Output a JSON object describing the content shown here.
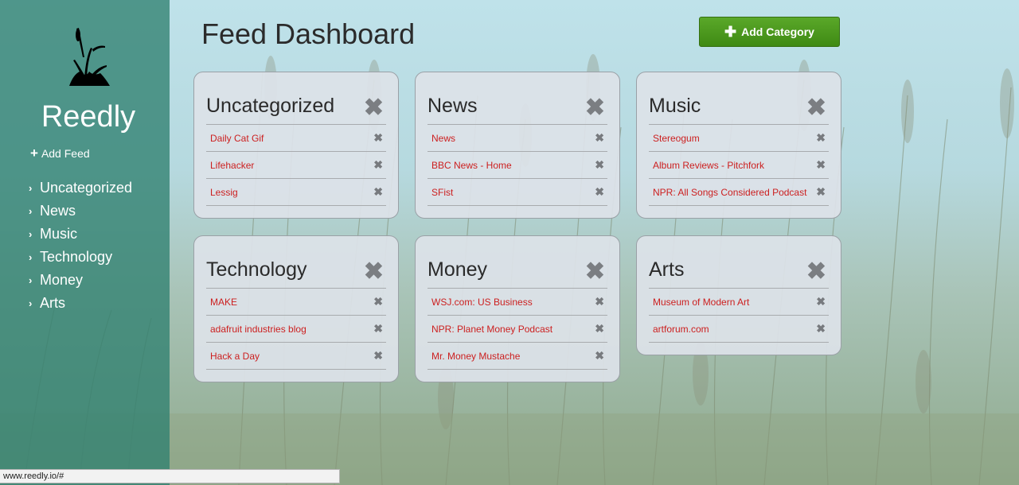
{
  "sidebar": {
    "brand": "Reedly",
    "add_feed_label": "Add Feed",
    "categories": [
      {
        "label": "Uncategorized"
      },
      {
        "label": "News"
      },
      {
        "label": "Music"
      },
      {
        "label": "Technology"
      },
      {
        "label": "Money"
      },
      {
        "label": "Arts"
      }
    ]
  },
  "header": {
    "title": "Feed Dashboard",
    "add_category_label": "Add Category"
  },
  "cards": [
    {
      "title": "Uncategorized",
      "feeds": [
        "Daily Cat Gif",
        "Lifehacker",
        "Lessig"
      ]
    },
    {
      "title": "News",
      "feeds": [
        "News",
        "BBC News - Home",
        "SFist"
      ]
    },
    {
      "title": "Music",
      "feeds": [
        "Stereogum",
        "Album Reviews - Pitchfork",
        "NPR: All Songs Considered Podcast"
      ]
    },
    {
      "title": "Technology",
      "feeds": [
        "MAKE",
        "adafruit industries blog",
        "Hack a Day"
      ]
    },
    {
      "title": "Money",
      "feeds": [
        "WSJ.com: US Business",
        "NPR: Planet Money Podcast",
        "Mr. Money Mustache"
      ]
    },
    {
      "title": "Arts",
      "feeds": [
        "Museum of Modern Art",
        "artforum.com"
      ]
    }
  ],
  "status_url": "www.reedly.io/#",
  "colors": {
    "sidebar": "#308070",
    "button": "#4a9a1e",
    "feed_link": "#cc1f1f"
  },
  "icons": {
    "close": "close-icon",
    "plus": "plus-icon",
    "chevron": "chevron-right-icon",
    "logo": "reed-logo"
  }
}
